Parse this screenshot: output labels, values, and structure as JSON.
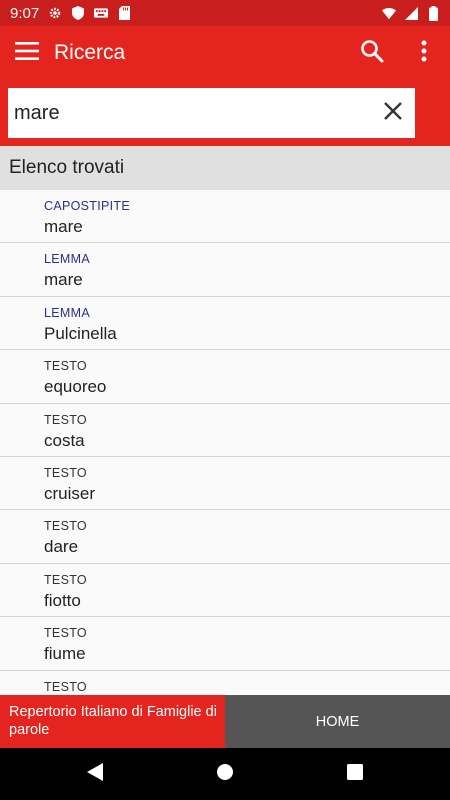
{
  "status_bar": {
    "time": "9:07",
    "icons_left": [
      "gear-icon",
      "shield-icon",
      "keyboard-icon",
      "sd-card-icon"
    ],
    "icons_right": [
      "wifi-icon",
      "signal-icon",
      "battery-icon"
    ]
  },
  "app_bar": {
    "title": "Ricerca",
    "icons": [
      "menu-icon",
      "search-icon",
      "more-vert-icon"
    ]
  },
  "search": {
    "value": "mare",
    "clear_icon": "close-icon"
  },
  "section": {
    "title": "Elenco trovati"
  },
  "results": [
    {
      "category": "CAPOSTIPITE",
      "word": "mare",
      "highlight": true
    },
    {
      "category": "LEMMA",
      "word": "mare",
      "highlight": true
    },
    {
      "category": "LEMMA",
      "word": "Pulcinella",
      "highlight": true
    },
    {
      "category": "TESTO",
      "word": "equoreo",
      "highlight": false
    },
    {
      "category": "TESTO",
      "word": "costa",
      "highlight": false
    },
    {
      "category": "TESTO",
      "word": "cruiser",
      "highlight": false
    },
    {
      "category": "TESTO",
      "word": "dare",
      "highlight": false
    },
    {
      "category": "TESTO",
      "word": "fiotto",
      "highlight": false
    },
    {
      "category": "TESTO",
      "word": "fiume",
      "highlight": false
    },
    {
      "category": "TESTO",
      "word": "",
      "highlight": false
    }
  ],
  "bottom": {
    "brand": "Repertorio Italiano di Famiglie di parole",
    "home": "HOME"
  },
  "colors": {
    "primary": "#e3241f",
    "status": "#c81e1e",
    "accent_blue": "#2b2f8a",
    "home_bg": "#555555"
  }
}
